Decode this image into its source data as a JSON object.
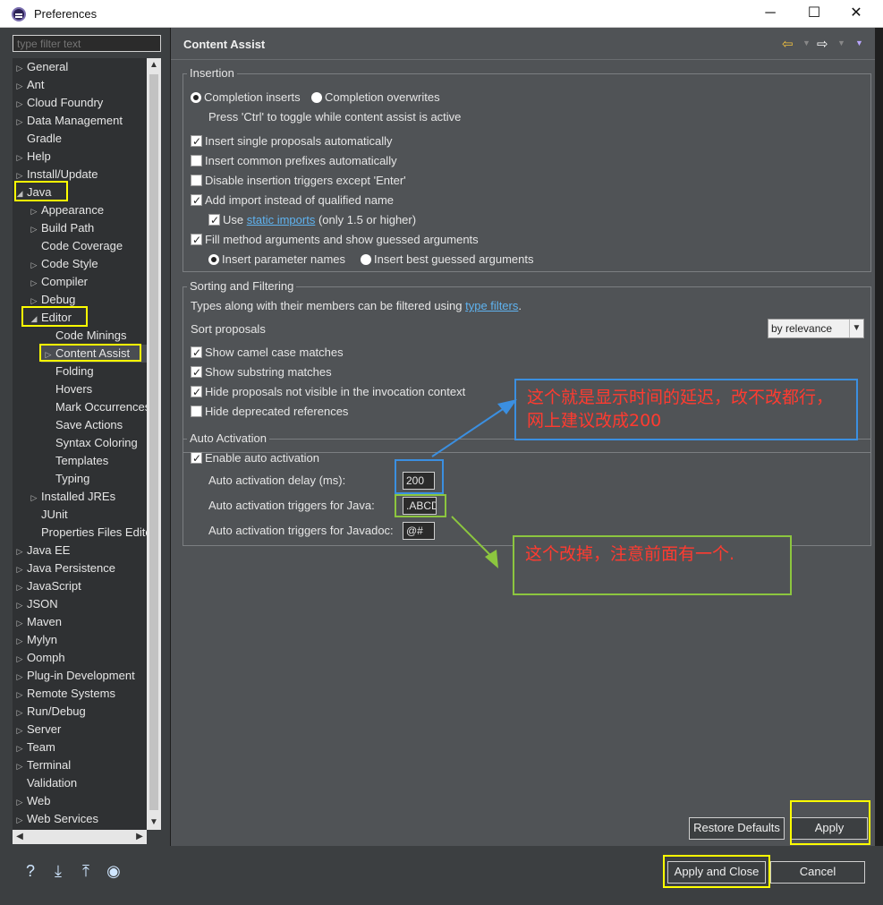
{
  "window": {
    "title": "Preferences",
    "minimize": "─",
    "maximize": "☐",
    "close": "✕"
  },
  "left": {
    "filter_placeholder": "type filter text",
    "tree": [
      {
        "label": "General",
        "level": 0,
        "arrow": "▷"
      },
      {
        "label": "Ant",
        "level": 0,
        "arrow": "▷"
      },
      {
        "label": "Cloud Foundry",
        "level": 0,
        "arrow": "▷"
      },
      {
        "label": "Data Management",
        "level": 0,
        "arrow": "▷"
      },
      {
        "label": "Gradle",
        "level": 0,
        "arrow": ""
      },
      {
        "label": "Help",
        "level": 0,
        "arrow": "▷"
      },
      {
        "label": "Install/Update",
        "level": 0,
        "arrow": "▷"
      },
      {
        "label": "Java",
        "level": 0,
        "arrow": "◢"
      },
      {
        "label": "Appearance",
        "level": 1,
        "arrow": "▷"
      },
      {
        "label": "Build Path",
        "level": 1,
        "arrow": "▷"
      },
      {
        "label": "Code Coverage",
        "level": 1,
        "arrow": ""
      },
      {
        "label": "Code Style",
        "level": 1,
        "arrow": "▷"
      },
      {
        "label": "Compiler",
        "level": 1,
        "arrow": "▷"
      },
      {
        "label": "Debug",
        "level": 1,
        "arrow": "▷"
      },
      {
        "label": "Editor",
        "level": 1,
        "arrow": "◢"
      },
      {
        "label": "Code Minings",
        "level": 2,
        "arrow": ""
      },
      {
        "label": "Content Assist",
        "level": 2,
        "arrow": "▷"
      },
      {
        "label": "Folding",
        "level": 2,
        "arrow": ""
      },
      {
        "label": "Hovers",
        "level": 2,
        "arrow": ""
      },
      {
        "label": "Mark Occurrences",
        "level": 2,
        "arrow": ""
      },
      {
        "label": "Save Actions",
        "level": 2,
        "arrow": ""
      },
      {
        "label": "Syntax Coloring",
        "level": 2,
        "arrow": ""
      },
      {
        "label": "Templates",
        "level": 2,
        "arrow": ""
      },
      {
        "label": "Typing",
        "level": 2,
        "arrow": ""
      },
      {
        "label": "Installed JREs",
        "level": 1,
        "arrow": "▷"
      },
      {
        "label": "JUnit",
        "level": 1,
        "arrow": ""
      },
      {
        "label": "Properties Files Editor",
        "level": 1,
        "arrow": ""
      },
      {
        "label": "Java EE",
        "level": 0,
        "arrow": "▷"
      },
      {
        "label": "Java Persistence",
        "level": 0,
        "arrow": "▷"
      },
      {
        "label": "JavaScript",
        "level": 0,
        "arrow": "▷"
      },
      {
        "label": "JSON",
        "level": 0,
        "arrow": "▷"
      },
      {
        "label": "Maven",
        "level": 0,
        "arrow": "▷"
      },
      {
        "label": "Mylyn",
        "level": 0,
        "arrow": "▷"
      },
      {
        "label": "Oomph",
        "level": 0,
        "arrow": "▷"
      },
      {
        "label": "Plug-in Development",
        "level": 0,
        "arrow": "▷"
      },
      {
        "label": "Remote Systems",
        "level": 0,
        "arrow": "▷"
      },
      {
        "label": "Run/Debug",
        "level": 0,
        "arrow": "▷"
      },
      {
        "label": "Server",
        "level": 0,
        "arrow": "▷"
      },
      {
        "label": "Team",
        "level": 0,
        "arrow": "▷"
      },
      {
        "label": "Terminal",
        "level": 0,
        "arrow": "▷"
      },
      {
        "label": "Validation",
        "level": 0,
        "arrow": ""
      },
      {
        "label": "Web",
        "level": 0,
        "arrow": "▷"
      },
      {
        "label": "Web Services",
        "level": 0,
        "arrow": "▷"
      }
    ],
    "selected": "Content Assist"
  },
  "page": {
    "title": "Content Assist",
    "insertion": {
      "legend": "Insertion",
      "radio_inserts": "Completion inserts",
      "radio_overwrites": "Completion overwrites",
      "toggle_hint": "Press 'Ctrl' to toggle while content assist is active",
      "single_proposals": "Insert single proposals automatically",
      "common_prefixes": "Insert common prefixes automatically",
      "disable_triggers": "Disable insertion triggers except 'Enter'",
      "add_import": "Add import instead of qualified name",
      "use_label": "Use",
      "static_imports_link": "static imports",
      "only_15": "(only 1.5 or higher)",
      "fill_args": "Fill method arguments and show guessed arguments",
      "insert_param_names": "Insert parameter names",
      "insert_best_guessed": "Insert best guessed arguments"
    },
    "sorting": {
      "legend": "Sorting and Filtering",
      "types_text": "Types along with their members can be filtered using",
      "type_filters_link": "type filters",
      "period": ".",
      "sort_label": "Sort proposals",
      "sort_value": "by relevance",
      "camel": "Show camel case matches",
      "substring": "Show substring matches",
      "hide_not_visible": "Hide proposals not visible in the invocation context",
      "hide_deprecated": "Hide deprecated references"
    },
    "auto": {
      "legend": "Auto Activation",
      "enable": "Enable auto activation",
      "delay_label": "Auto activation delay (ms):",
      "delay_value": "200",
      "java_triggers_label": "Auto activation triggers for Java:",
      "java_triggers_value": ".ABCD",
      "javadoc_triggers_label": "Auto activation triggers for Javadoc:",
      "javadoc_triggers_value": "@#"
    },
    "restore_defaults": "Restore Defaults",
    "apply": "Apply"
  },
  "bottom": {
    "apply_close": "Apply and Close",
    "cancel": "Cancel"
  },
  "annotations": {
    "blue_note": "这个就是显示时间的延迟，改不改都行，网上建议改成200",
    "green_note": "这个改掉，注意前面有一个."
  }
}
